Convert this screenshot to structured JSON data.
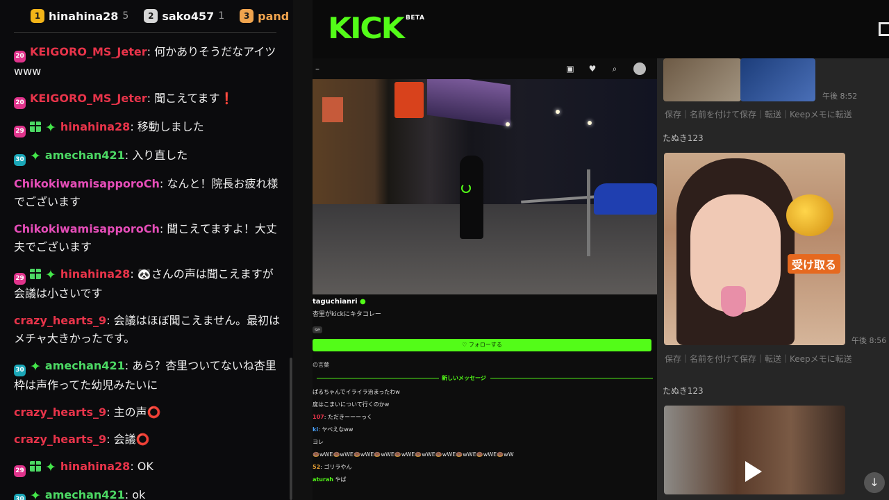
{
  "leaderboard": [
    {
      "rank": "1",
      "name": "hinahina28",
      "count": "5"
    },
    {
      "rank": "2",
      "name": "sako457",
      "count": "1"
    },
    {
      "rank": "3",
      "name": "pand",
      "count": ""
    }
  ],
  "chat": [
    {
      "user": "KEIGORO_MS_Jeter",
      "text": "何かありそうだなアイツwww",
      "color": "#e8344a",
      "badge": "20"
    },
    {
      "user": "KEIGORO_MS_Jeter",
      "text": "聞こえてます❗",
      "color": "#e8344a",
      "badge": "20"
    },
    {
      "user": "hinahina28",
      "text": "移動しました",
      "color": "#e8344a",
      "badge": "29"
    },
    {
      "user": "amechan421",
      "text": "入り直した",
      "color": "#4cd964",
      "badge": "30"
    },
    {
      "user": "ChikokiwamisapporoCh",
      "text": "なんと！院長お疲れ様でございます",
      "color": "#e54db8"
    },
    {
      "user": "ChikokiwamisapporoCh",
      "text": "聞こえてますよ！大丈夫でございます",
      "color": "#e54db8"
    },
    {
      "user": "hinahina28",
      "text": "🐼さんの声は聞こえますが会議は小さいです",
      "color": "#e8344a",
      "badge": "29"
    },
    {
      "user": "crazy_hearts_9",
      "text": "会議はほぼ聞こえません。最初はメチャ大きかったです。",
      "color": "#e8344a"
    },
    {
      "user": "amechan421",
      "text": "あら？杏里ついてないね杏里枠は声作ってた幼児みたいに",
      "color": "#4cd964",
      "badge": "30"
    },
    {
      "user": "crazy_hearts_9",
      "text": "主の声⭕",
      "color": "#e8344a"
    },
    {
      "user": "crazy_hearts_9",
      "text": "会議⭕",
      "color": "#e8344a"
    },
    {
      "user": "hinahina28",
      "text": "OK",
      "color": "#e8344a",
      "badge": "29"
    },
    {
      "user": "amechan421",
      "text": "ok",
      "color": "#4cd964",
      "badge": "30"
    }
  ],
  "kick": {
    "logo": "KICK",
    "beta": "BETA"
  },
  "phone": {
    "channel": "taguchianri",
    "subtitle": "杏里がkickにキタコレー",
    "tag": "se",
    "follow_label": "♡ フォローする",
    "pinned": "の言葉",
    "new_messages": "新しいメッセージ",
    "messages": [
      {
        "user": "",
        "text": "ぱるちゃんでイライラ治まったわw"
      },
      {
        "user": "",
        "text": "度はこまいについて行くのかw"
      },
      {
        "user": "107",
        "text": "ただきーーーっく"
      },
      {
        "user": "ki",
        "text": "ヤベえなww"
      },
      {
        "user": "",
        "text": "ヨレ"
      },
      {
        "user": "",
        "text": "🍩wWE🍩wWE🍩wWE🍩wWE🍩wWE🍩wWE🍩wWE🍩wWE🍩wWE🍩wW"
      },
      {
        "user": "52",
        "text": "ゴリラやん"
      },
      {
        "user": "aturah",
        "text": "やば"
      }
    ]
  },
  "line": {
    "time1": "午後 8:52",
    "actions": "保存｜名前を付けて保存｜転送｜Keepメモに転送",
    "sender": "たぬき123",
    "overlay_label": "受け取る",
    "time2": "午後 8:56"
  }
}
